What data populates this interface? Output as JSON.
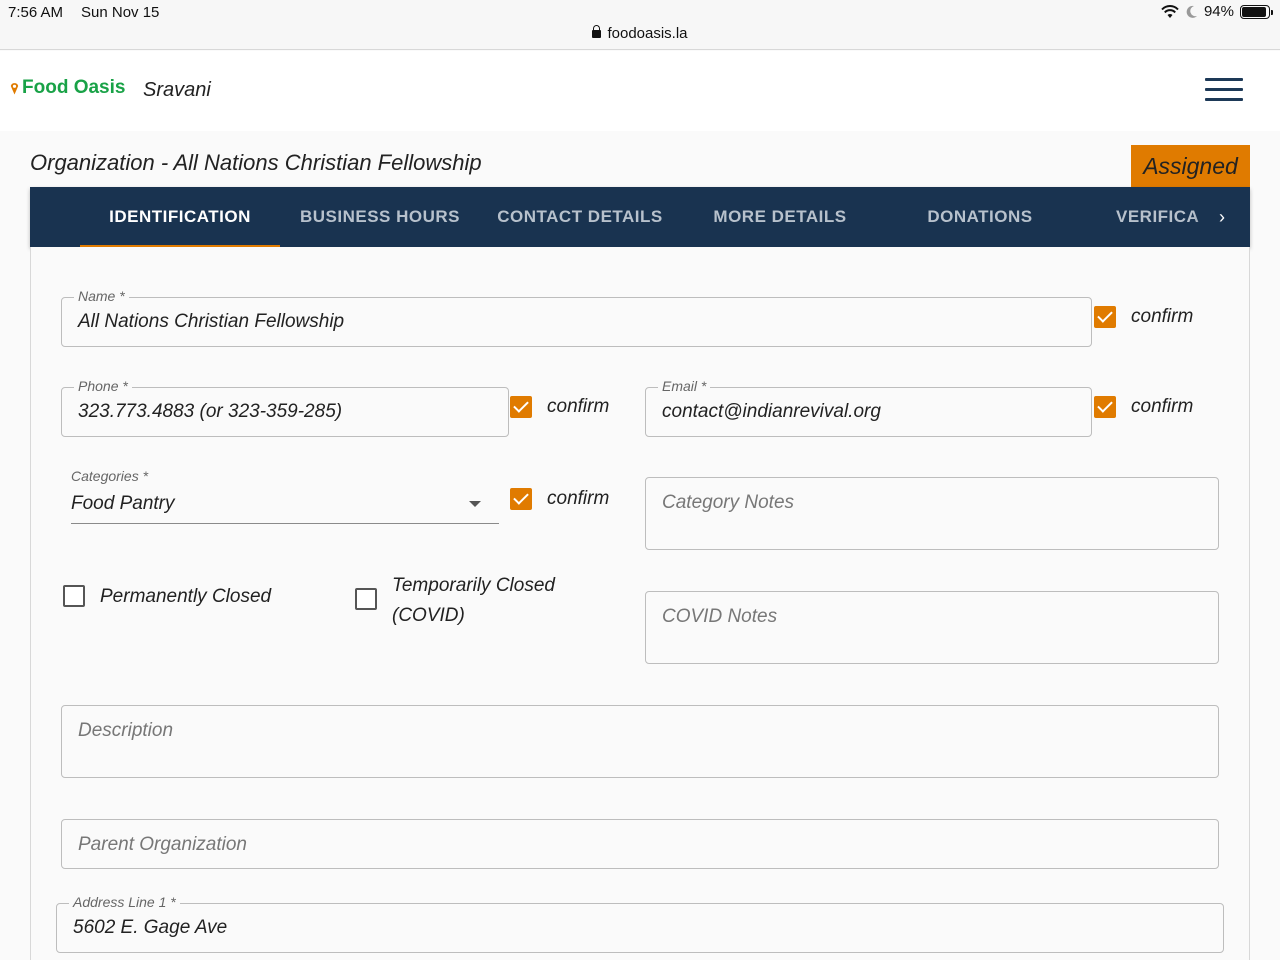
{
  "status_bar": {
    "time": "7:56 AM",
    "date": "Sun Nov 15",
    "url": "foodoasis.la",
    "battery": "94%",
    "battery_level": 0.94
  },
  "header": {
    "logo_text": "Food Oasis",
    "username": "Sravani"
  },
  "org_title": "Organization - All Nations Christian Fellowship",
  "status_badge": "Assigned",
  "tabs": [
    {
      "label": "IDENTIFICATION"
    },
    {
      "label": "BUSINESS HOURS"
    },
    {
      "label": "CONTACT DETAILS"
    },
    {
      "label": "MORE DETAILS"
    },
    {
      "label": "DONATIONS"
    },
    {
      "label": "VERIFICA"
    }
  ],
  "active_tab": "IDENTIFICATION",
  "form": {
    "confirm_label": "confirm",
    "name": {
      "label": "Name *",
      "value": "All Nations Christian Fellowship",
      "confirmed": true
    },
    "phone": {
      "label": "Phone *",
      "value": "323.773.4883 (or 323-359-285)",
      "confirmed": true
    },
    "email": {
      "label": "Email *",
      "value": "contact@indianrevival.org",
      "confirmed": true
    },
    "categories": {
      "label": "Categories *",
      "value": "Food Pantry",
      "confirmed": true
    },
    "category_notes": {
      "placeholder": "Category Notes"
    },
    "permanently_closed": {
      "label": "Permanently Closed",
      "checked": false
    },
    "temporarily_closed": {
      "label_line1": "Temporarily Closed",
      "label_line2": "(COVID)",
      "checked": false
    },
    "covid_notes": {
      "placeholder": "COVID Notes"
    },
    "description": {
      "placeholder": "Description"
    },
    "parent_org": {
      "placeholder": "Parent Organization"
    },
    "address1": {
      "label": "Address Line 1 *",
      "value": "5602 E. Gage Ave"
    }
  }
}
